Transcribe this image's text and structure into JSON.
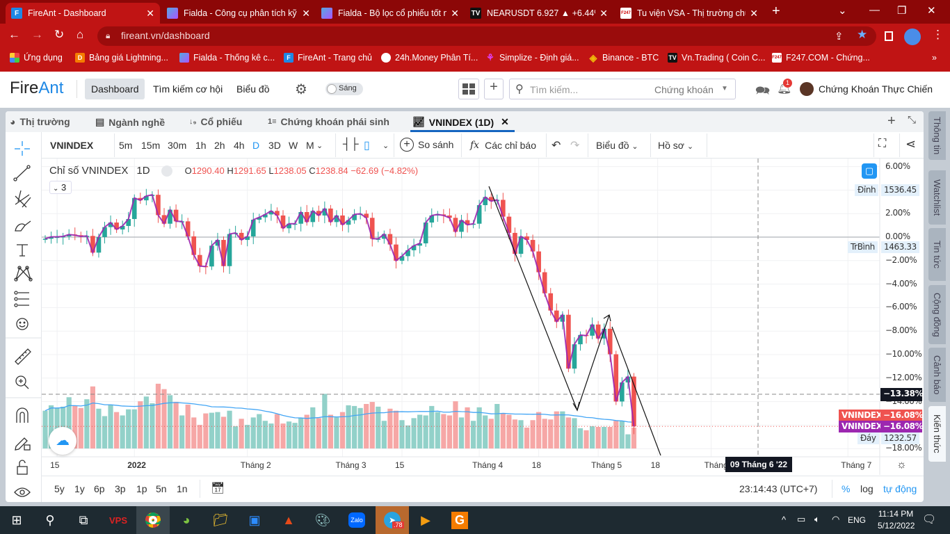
{
  "browser": {
    "tabs": [
      {
        "title": "FireAnt - Dashboard",
        "icon": "F",
        "active": true
      },
      {
        "title": "Fialda - Công cụ phân tích kỹ",
        "icon": "fialda"
      },
      {
        "title": "Fialda - Bộ lọc cổ phiếu tốt n",
        "icon": "fialda"
      },
      {
        "title": "NEARUSDT 6.927 ▲ +6.44%",
        "icon": "TV"
      },
      {
        "title": "Tu viện VSA - Thị trường chứ",
        "icon": "F247"
      }
    ],
    "new_tab": "+",
    "url": "fireant.vn/dashboard",
    "bookmarks": [
      {
        "label": "Ứng dụng"
      },
      {
        "label": "Bảng giá Lightning..."
      },
      {
        "label": "Fialda - Thống kê c..."
      },
      {
        "label": "FireAnt - Trang chủ"
      },
      {
        "label": "24h.Money Phân Tí..."
      },
      {
        "label": "Simplize - Định giá..."
      },
      {
        "label": "Binance - BTC"
      },
      {
        "label": "Vn.Trading ( Coin C..."
      },
      {
        "label": "F247.COM - Chứng..."
      }
    ],
    "more": "»"
  },
  "header": {
    "logo_a": "Fire",
    "logo_b": "Ant",
    "nav": [
      "Dashboard",
      "Tìm kiếm cơ hội",
      "Biểu đồ"
    ],
    "theme": "Sáng",
    "search_placeholder": "Tìm kiếm...",
    "search_scope": "Chứng khoán",
    "notif_count": "1",
    "user": "Chứng Khoán Thực Chiến"
  },
  "panel_tabs": [
    "Thị trường",
    "Ngành nghề",
    "Cổ phiếu",
    "Chứng khoán phái sinh",
    "VNINDEX (1D)"
  ],
  "chart_toolbar": {
    "symbol": "VNINDEX",
    "intervals": [
      "5m",
      "15m",
      "30m",
      "1h",
      "2h",
      "4h",
      "D",
      "3D",
      "W",
      "M"
    ],
    "active_interval": "D",
    "compare": "So sánh",
    "indicators": "Các chỉ báo",
    "chart": "Biểu đồ",
    "profile": "Hồ sơ"
  },
  "legend": {
    "title": "Chỉ số VNINDEX",
    "interval": "1D",
    "o_label": "O",
    "o": "1290.40",
    "h_label": "H",
    "h": "1291.65",
    "l_label": "L",
    "l": "1238.05",
    "c_label": "C",
    "c": "1238.84",
    "change": "−62.69 (−4.82%)",
    "indicators_count": "3"
  },
  "price_labels": {
    "top_label": "Đỉnh",
    "top": "1536.45",
    "avg_label": "TrBình",
    "avg": "1463.33",
    "bottom_label": "Đáy",
    "bottom": "1232.57",
    "cross": "−13.38%",
    "last1_name": "VNINDEX",
    "last1": "−16.08%",
    "last2_name": "VNINDEX",
    "last2": "−16.08%",
    "cross_date": "09 Tháng 6 '22"
  },
  "side_tabs": [
    "Thông tin",
    "Watchlist",
    "Tin tức",
    "Cộng đồng",
    "Cảnh báo",
    "Kiến thức"
  ],
  "ranges": [
    "5y",
    "1y",
    "6p",
    "3p",
    "1p",
    "5n",
    "1n"
  ],
  "bottom": {
    "time": "23:14:43 (UTC+7)",
    "pct": "%",
    "log": "log",
    "auto": "tự động"
  },
  "taskbar": {
    "lang": "ENG",
    "time": "11:14 PM",
    "date": "5/12/2022",
    "telegram_badge": ".78"
  },
  "colors": {
    "up": "#26a69a",
    "down": "#ef5350",
    "accent": "#2196f3",
    "line": "#9c27b0",
    "chrome": "#c01414"
  },
  "chart_data": {
    "type": "candlestick",
    "symbol": "VNINDEX",
    "y_unit": "percent change",
    "ylim": [
      -18,
      6
    ],
    "y_ticks": [
      "6.00%",
      "2.00%",
      "0.00%",
      "−2.00%",
      "−4.00%",
      "−6.00%",
      "−8.00%",
      "−10.00%",
      "−12.00%",
      "−14.00%",
      "−18.00%"
    ],
    "y_tick_values": [
      6,
      2,
      0,
      -2,
      -4,
      -6,
      -8,
      -10,
      -12,
      -14,
      -18
    ],
    "x_ticks": [
      "15",
      "2022",
      "Tháng 2",
      "Tháng 3",
      "15",
      "Tháng 4",
      "18",
      "Tháng 5",
      "18",
      "Tháng 6",
      "Tháng 7"
    ],
    "x_tick_index": [
      2,
      15,
      34,
      50,
      60,
      73,
      83,
      93,
      103,
      112,
      135
    ],
    "first_open": -0.2,
    "close": [
      -0.14,
      0.02,
      0.02,
      0.06,
      0.22,
      0.16,
      0.06,
      0.1,
      -1.32,
      0.0,
      0.85,
      1.24,
      0.65,
      0.95,
      1.54,
      3.33,
      3.13,
      3.5,
      3.6,
      1.87,
      1.14,
      2.33,
      1.34,
      1.34,
      0.06,
      -1.52,
      -2.47,
      -2.5,
      -0.73,
      -0.24,
      -2.47,
      0.26,
      0.36,
      -0.24,
      0.06,
      1.48,
      1.68,
      1.93,
      2.23,
      1.84,
      0.75,
      1.14,
      1.14,
      2.13,
      1.28,
      2.23,
      1.84,
      2.43,
      1.28,
      1.84,
      1.05,
      1.44,
      1.93,
      1.99,
      1.64,
      -0.14,
      -0.14,
      0.26,
      -0.63,
      -2.01,
      -1.62,
      -1.12,
      -0.73,
      -0.53,
      1.24,
      1.84,
      1.93,
      1.84,
      1.64,
      0.45,
      1.44,
      1.05,
      1.14,
      2.72,
      3.41,
      3.06,
      3.17,
      1.74,
      0.36,
      -1.42,
      0.06,
      -0.24,
      -1.22,
      -2.99,
      -4.78,
      -6.25,
      -7.2,
      -6.61,
      -11.19,
      -9.12,
      -8.33,
      -8.39,
      -7.44,
      -8.63,
      -7.8,
      -9.97,
      -13.99,
      -12.37,
      -11.87,
      -16.11
    ],
    "volume": [
      56,
      64,
      60,
      62,
      76,
      63,
      60,
      73,
      92,
      59,
      48,
      65,
      54,
      49,
      58,
      58,
      70,
      77,
      67,
      96,
      88,
      79,
      69,
      49,
      65,
      46,
      35,
      52,
      53,
      54,
      47,
      56,
      33,
      44,
      35,
      46,
      51,
      41,
      37,
      51,
      37,
      40,
      38,
      45,
      50,
      61,
      45,
      81,
      50,
      46,
      54,
      64,
      63,
      60,
      66,
      69,
      62,
      41,
      59,
      56,
      42,
      34,
      45,
      50,
      49,
      63,
      54,
      51,
      49,
      70,
      46,
      61,
      41,
      61,
      49,
      44,
      66,
      52,
      50,
      43,
      42,
      31,
      42,
      54,
      44,
      43,
      55,
      55,
      46,
      45,
      30,
      27,
      33,
      32,
      32,
      32,
      41,
      41,
      21,
      31
    ],
    "volume_ma_period": 20
  }
}
